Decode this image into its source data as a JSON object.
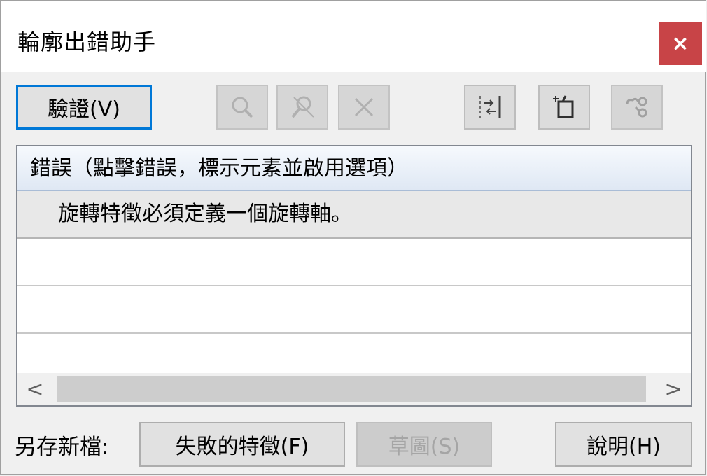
{
  "window": {
    "title": "輪廓出錯助手",
    "close_glyph": "×"
  },
  "toolbar": {
    "verify_label": "驗證(V)",
    "icons": [
      "zoom-icon",
      "zoom-out-icon",
      "delete-icon",
      "next-error-icon",
      "paste-icon",
      "hide-icon"
    ]
  },
  "errors": {
    "header": "錯誤（點擊錯誤，標示元素並啟用選項）",
    "rows": [
      "旋轉特徵必須定義一個旋轉軸。",
      "",
      "",
      ""
    ]
  },
  "scrollbar": {
    "left_glyph": "<",
    "right_glyph": ">"
  },
  "footer": {
    "save_label": "另存新檔:",
    "failed_feature_label": "失敗的特徵(F)",
    "sketch_label": "草圖(S)",
    "help_label": "說明(H)"
  },
  "colors": {
    "accent": "#0078d7",
    "close": "#c84447"
  }
}
